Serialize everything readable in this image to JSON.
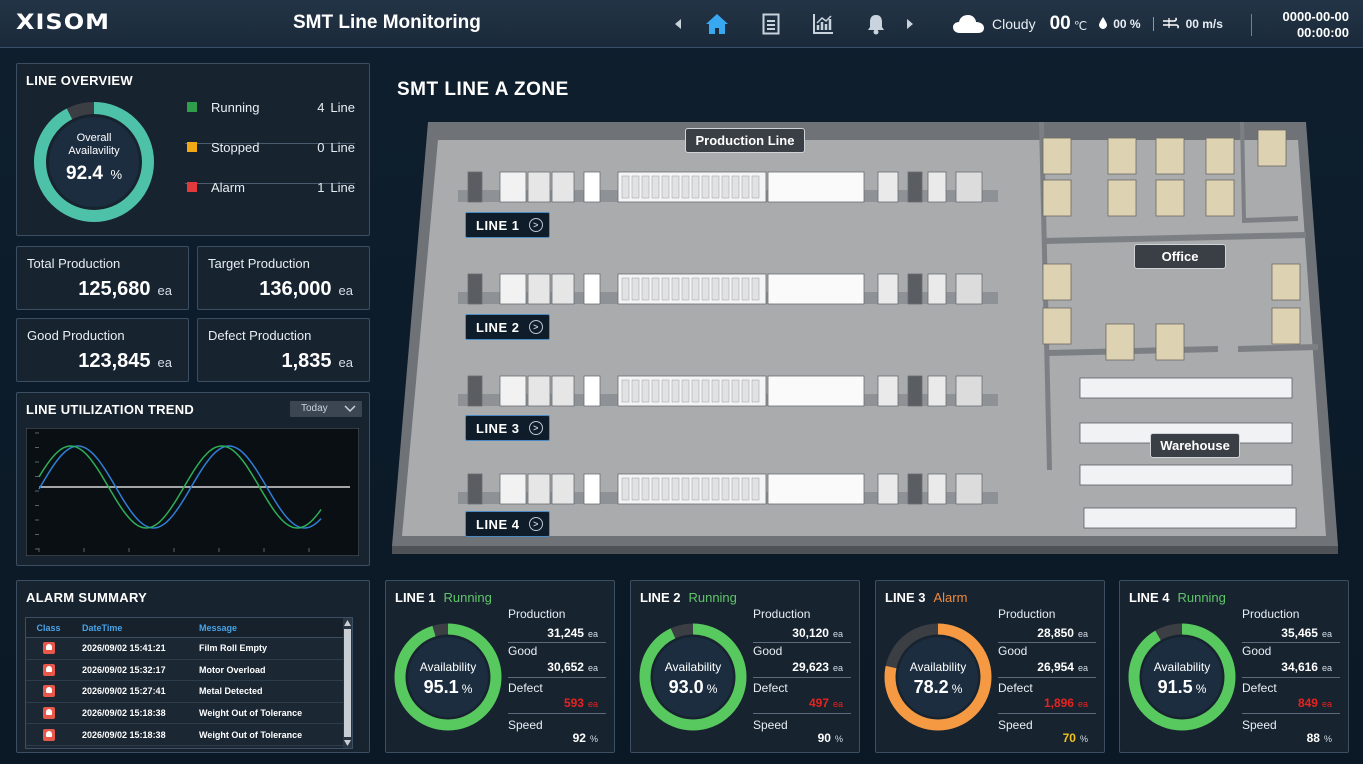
{
  "header": {
    "logo": "XISOM",
    "title": "SMT Line Monitoring",
    "weather": {
      "condition": "Cloudy",
      "temp": "00",
      "temp_unit": "℃",
      "humidity": "00 %",
      "wind": "00 m/s"
    },
    "date": "0000-00-00",
    "time": "00:00:00"
  },
  "line_overview": {
    "title": "LINE OVERVIEW",
    "ring_label": "Overall\nAvailavility",
    "availability": 92.4,
    "availability_text": "92.4",
    "percent": "%",
    "legend": [
      {
        "name": "Running",
        "count": "4",
        "unit": "Line",
        "color": "#2e9e4a"
      },
      {
        "name": "Stopped",
        "count": "0",
        "unit": "Line",
        "color": "#f0a814"
      },
      {
        "name": "Alarm",
        "count": "1",
        "unit": "Line",
        "color": "#e03a3a"
      }
    ]
  },
  "stats": [
    {
      "label": "Total Production",
      "value": "125,680",
      "unit": "ea"
    },
    {
      "label": "Target Production",
      "value": "136,000",
      "unit": "ea"
    },
    {
      "label": "Good Production",
      "value": "123,845",
      "unit": "ea"
    },
    {
      "label": "Defect Production",
      "value": "1,835",
      "unit": "ea"
    }
  ],
  "trend": {
    "title": "LINE UTILIZATION TREND",
    "period": "Today"
  },
  "alarm_summary": {
    "title": "ALARM SUMMARY",
    "columns": [
      "Class",
      "DateTime",
      "Message"
    ],
    "rows": [
      {
        "datetime": "2026/09/02 15:41:21",
        "message": "Film Roll Empty"
      },
      {
        "datetime": "2026/09/02 15:32:17",
        "message": "Motor Overload"
      },
      {
        "datetime": "2026/09/02 15:27:41",
        "message": "Metal Detected"
      },
      {
        "datetime": "2026/09/02 15:18:38",
        "message": "Weight Out of Tolerance"
      },
      {
        "datetime": "2026/09/02 15:18:38",
        "message": "Weight Out of Tolerance"
      }
    ]
  },
  "floor": {
    "title": "SMT LINE A ZONE",
    "zones": {
      "production": "Production Line",
      "office": "Office",
      "warehouse": "Warehouse"
    },
    "lines": [
      "LINE 1",
      "LINE 2",
      "LINE 3",
      "LINE 4"
    ]
  },
  "line_cards": [
    {
      "name": "LINE 1",
      "status": "Running",
      "status_color": "#5fc56a",
      "ring_color": "#57c95f",
      "availability": 95.1,
      "availability_text": "95.1",
      "production": "31,245",
      "good": "30,652",
      "defect": "593",
      "speed": "92",
      "speed_color": "#ffffff"
    },
    {
      "name": "LINE 2",
      "status": "Running",
      "status_color": "#5fc56a",
      "ring_color": "#57c95f",
      "availability": 93.0,
      "availability_text": "93.0",
      "production": "30,120",
      "good": "29,623",
      "defect": "497",
      "speed": "90",
      "speed_color": "#ffffff"
    },
    {
      "name": "LINE 3",
      "status": "Alarm",
      "status_color": "#f08a3c",
      "ring_color": "#f59a43",
      "availability": 78.2,
      "availability_text": "78.2",
      "production": "28,850",
      "good": "26,954",
      "defect": "1,896",
      "speed": "70",
      "speed_color": "#f2c21a"
    },
    {
      "name": "LINE 4",
      "status": "Running",
      "status_color": "#5fc56a",
      "ring_color": "#57c95f",
      "availability": 91.5,
      "availability_text": "91.5",
      "production": "35,465",
      "good": "34,616",
      "defect": "849",
      "speed": "88",
      "speed_color": "#ffffff"
    }
  ],
  "card_labels": {
    "availability": "Availability",
    "production": "Production",
    "good": "Good",
    "defect": "Defect",
    "speed": "Speed",
    "unit_ea": "ea",
    "unit_pct": "%"
  }
}
